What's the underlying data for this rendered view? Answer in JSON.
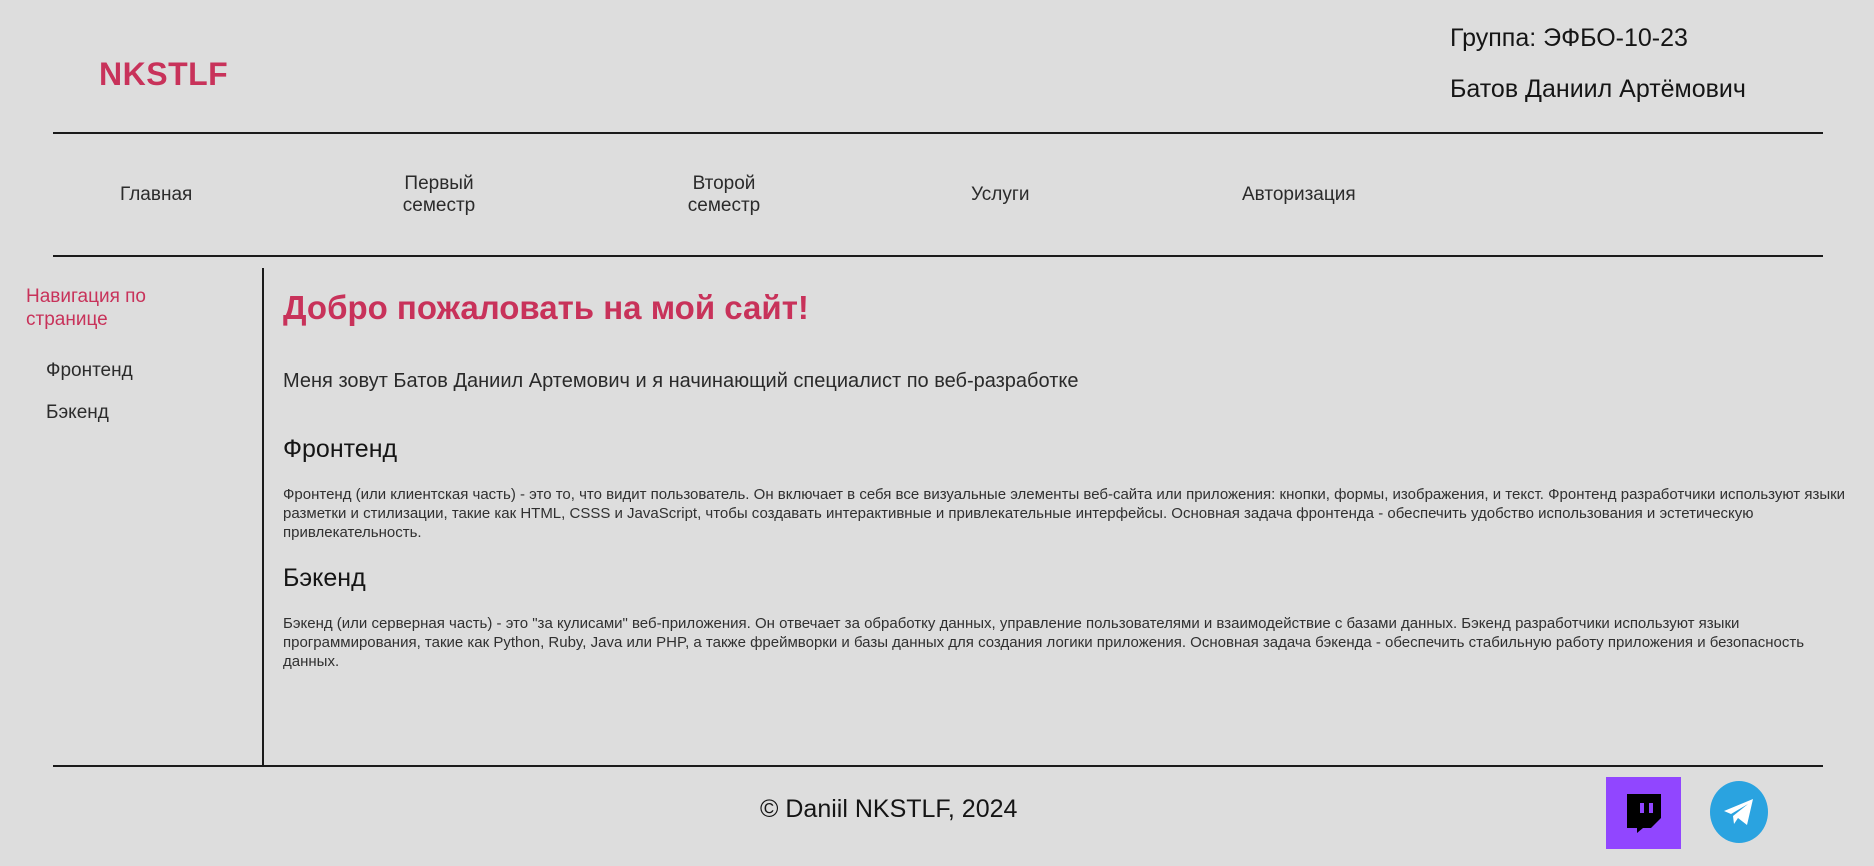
{
  "header": {
    "logo": "NKSTLF",
    "group": "Группа: ЭФБО-10-23",
    "student": "Батов Даниил Артёмович"
  },
  "nav": {
    "home": "Главная",
    "first_semester": "Первый семестр",
    "second_semester": "Второй семестр",
    "services": "Услуги",
    "auth": "Авторизация"
  },
  "sidebar": {
    "title": "Навигация по странице",
    "links": [
      "Фронтенд",
      "Бэкенд"
    ]
  },
  "main": {
    "heading": "Добро пожаловать на мой сайт!",
    "intro": "Меня зовут Батов Даниил Артемович и я начинающий специалист по веб-разработке",
    "frontend": {
      "title": "Фронтенд",
      "text": "Фронтенд (или клиентская часть) - это то, что видит пользователь. Он включает в себя все визуальные элементы веб-сайта или приложения: кнопки, формы, изображения, и текст. Фронтенд разработчики используют языки разметки и стилизации, такие как HTML, CSSS и JavaScript, чтобы создавать интерактивные и привлекательные интерфейсы. Основная задача фронтенда - обеспечить удобство использования и эстетическую привлекательность."
    },
    "backend": {
      "title": "Бэкенд",
      "text": "Бэкенд (или серверная часть) - это \"за кулисами\" веб-приложения. Он отвечает за обработку данных, управление пользователями и взаимодействие с базами данных. Бэкенд разработчики используют языки программирования, такие как Python, Ruby, Java или PHP, а также фреймворки и базы данных для создания логики приложения. Основная задача бэкенда - обеспечить стабильную работу приложения и безопасность данных."
    }
  },
  "footer": {
    "copyright": "© Daniil NKSTLF, 2024",
    "icons": [
      "twitch-icon",
      "telegram-icon"
    ]
  },
  "colors": {
    "background": "#dddddd",
    "accent": "#c8325a",
    "twitch": "#9146ff",
    "telegram": "#2aa3e0"
  }
}
